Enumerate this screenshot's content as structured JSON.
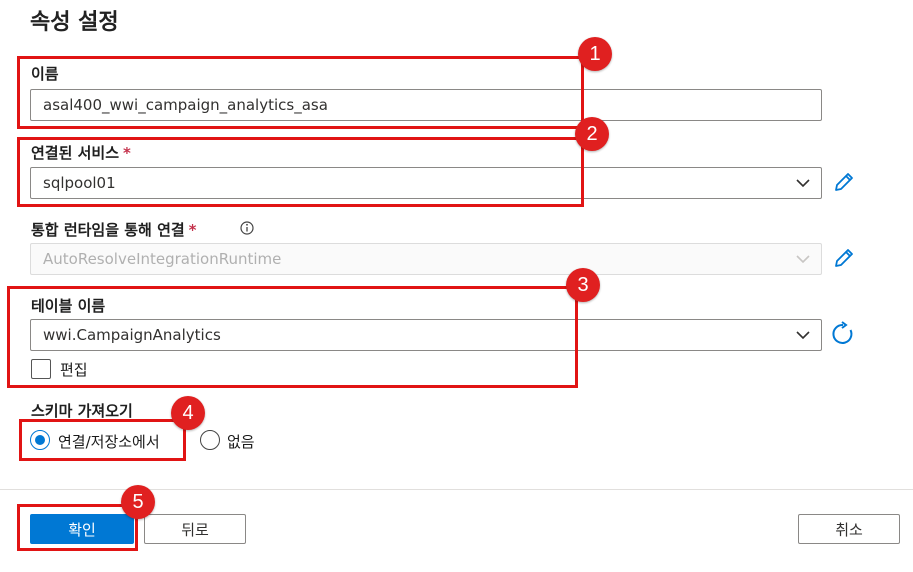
{
  "panel": {
    "title": "속성 설정"
  },
  "name_field": {
    "label": "이름",
    "value": "asal400_wwi_campaign_analytics_asa"
  },
  "linked_service": {
    "label": "연결된 서비스",
    "required_mark": "*",
    "value": "sqlpool01"
  },
  "integration_runtime": {
    "label": "통합 런타임을 통해 연결",
    "required_mark": "*",
    "value": "AutoResolveIntegrationRuntime",
    "disabled": true
  },
  "table_name": {
    "label": "테이블 이름",
    "value": "wwi.CampaignAnalytics",
    "edit_checkbox_label": "편집",
    "edit_checked": false
  },
  "import_schema": {
    "label": "스키마 가져오기",
    "options": [
      {
        "label": "연결/저장소에서",
        "selected": true
      },
      {
        "label": "없음",
        "selected": false
      }
    ]
  },
  "footer": {
    "ok_label": "확인",
    "back_label": "뒤로",
    "cancel_label": "취소"
  },
  "callouts": [
    "1",
    "2",
    "3",
    "4",
    "5"
  ],
  "colors": {
    "accent": "#0078d4",
    "callout_red": "#e02020",
    "highlight_border": "#e11414"
  }
}
